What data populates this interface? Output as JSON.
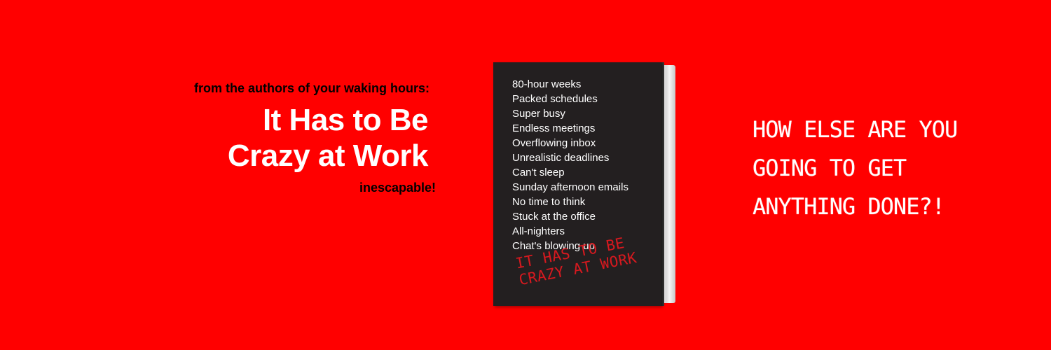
{
  "left": {
    "kicker": "from the authors of your waking hours:",
    "title_line_1": "It Has to Be",
    "title_line_2": "Crazy at Work",
    "tagline": "inescapable!"
  },
  "book": {
    "list": [
      "80-hour weeks",
      "Packed schedules",
      "Super busy",
      "Endless meetings",
      "Overflowing inbox",
      "Unrealistic deadlines",
      "Can't sleep",
      "Sunday afternoon emails",
      "No time to think",
      "Stuck at the office",
      "All-nighters",
      "Chat's blowing up"
    ],
    "stamp_line_1": "IT HAS TO BE",
    "stamp_line_2": "CRAZY AT WORK"
  },
  "right": {
    "line_1": "HOW ELSE ARE YOU",
    "line_2": "GOING TO GET",
    "line_3": "ANYTHING DONE?!"
  },
  "colors": {
    "background": "#ff0000",
    "cover": "#231f20",
    "stamp": "#d7191f",
    "headline": "#ffffff",
    "kicker": "#000000"
  }
}
